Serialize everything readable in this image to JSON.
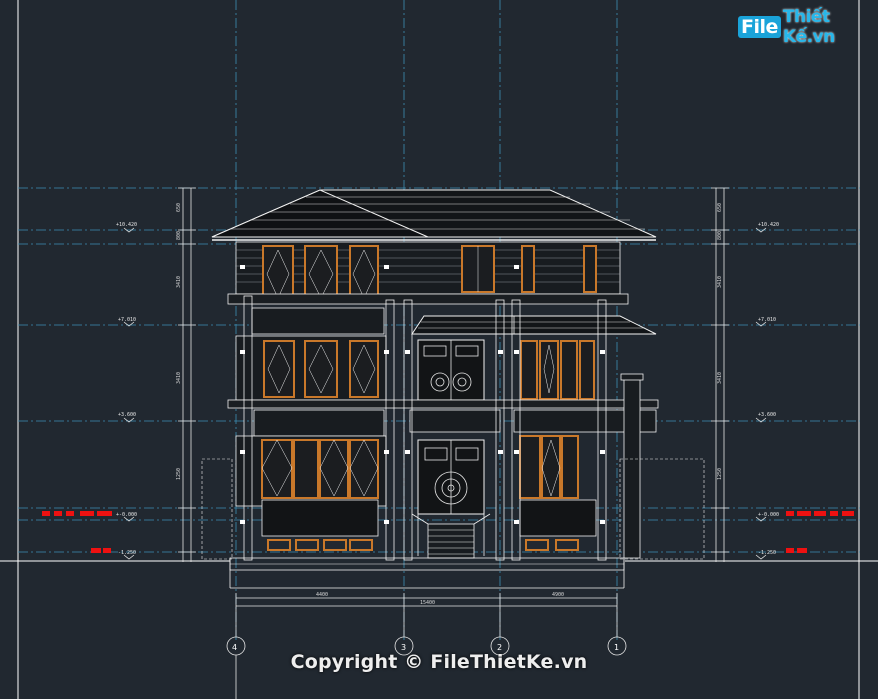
{
  "logo": {
    "brand_prefix": "File",
    "brand_rest": "Thiết Kế.vn"
  },
  "copyright": "Copyright © FileThietKe.vn",
  "levels": {
    "left": [
      "+10.420",
      "+7.010",
      "+3.600",
      "+-0.000",
      "-1.250"
    ],
    "right": [
      "+10.420",
      "+7.010",
      "+3.600",
      "+-0.000",
      "-1.250"
    ]
  },
  "dimensions": {
    "bottom": [
      "4400",
      "4900",
      "15400"
    ],
    "left_vertical": [
      "650",
      "800",
      "3410",
      "3410",
      "1250"
    ],
    "right_vertical": [
      "650",
      "800",
      "3410",
      "3410",
      "1250"
    ]
  },
  "grid_axes": [
    "4",
    "3",
    "2",
    "1"
  ],
  "colors": {
    "background": "#212830",
    "cad_white": "#f2f2f2",
    "frame_orange": "#c9782a",
    "grid_cyan": "#3d8fb5",
    "marker_red": "#ee1111"
  }
}
